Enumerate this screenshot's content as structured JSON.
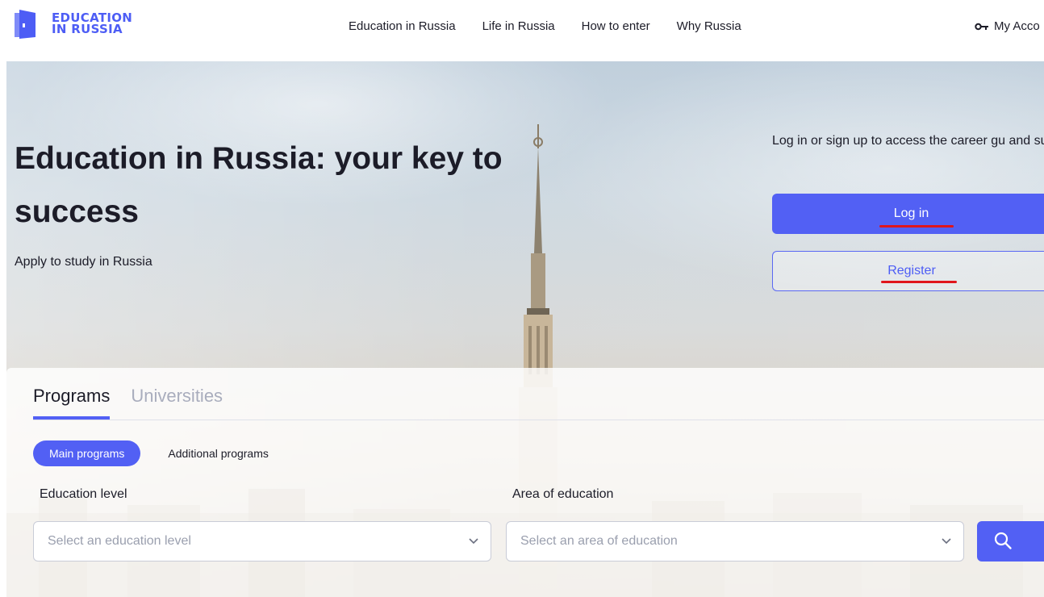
{
  "header": {
    "logo": {
      "line1": "EDUCATION",
      "line2": "IN RUSSIA",
      "icon": "door-logo-icon",
      "color": "#4d5df5"
    },
    "nav": [
      {
        "label": "Education in Russia"
      },
      {
        "label": "Life in Russia"
      },
      {
        "label": "How to enter"
      },
      {
        "label": "Why Russia"
      }
    ],
    "account": {
      "label": "My Acco",
      "icon": "key-icon"
    }
  },
  "hero": {
    "title": "Education in Russia: your key to success",
    "subtitle": "Apply to study in Russia",
    "login_prompt": "Log in or sign up to access the career gu and submit your application",
    "login_button": "Log in",
    "register_button": "Register"
  },
  "search": {
    "tabs": [
      {
        "label": "Programs",
        "active": true
      },
      {
        "label": "Universities",
        "active": false
      }
    ],
    "program_types": [
      {
        "label": "Main programs",
        "active": true
      },
      {
        "label": "Additional programs",
        "active": false
      }
    ],
    "education_level": {
      "label": "Education level",
      "placeholder": "Select an education level"
    },
    "area": {
      "label": "Area of education",
      "placeholder": "Select an area of education"
    },
    "search_icon": "search-icon"
  },
  "colors": {
    "accent": "#5260f4",
    "annotation": "#e0151b",
    "text": "#1c1c28"
  }
}
